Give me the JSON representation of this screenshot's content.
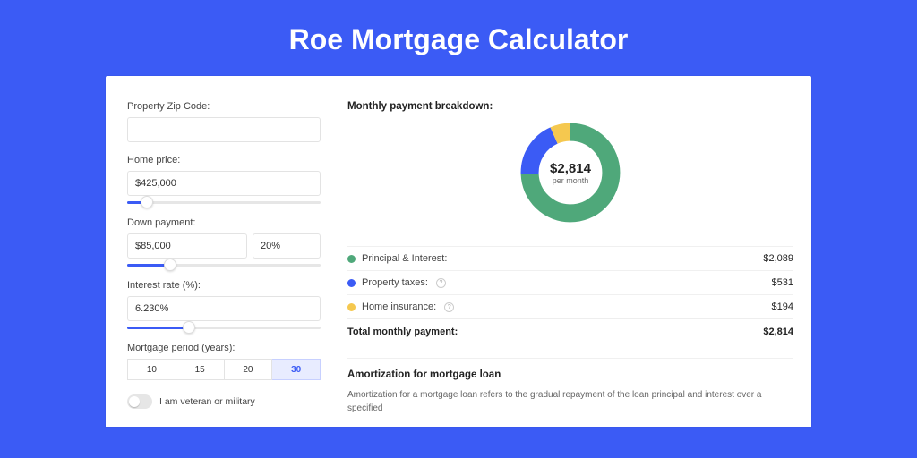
{
  "title": "Roe Mortgage Calculator",
  "form": {
    "zipLabel": "Property Zip Code:",
    "zipValue": "",
    "homePriceLabel": "Home price:",
    "homePriceValue": "$425,000",
    "homePriceSliderPct": 10,
    "downPaymentLabel": "Down payment:",
    "downPaymentValue": "$85,000",
    "downPaymentPctValue": "20%",
    "downPaymentSliderPct": 22,
    "interestLabel": "Interest rate (%):",
    "interestValue": "6.230%",
    "interestSliderPct": 32,
    "periodLabel": "Mortgage period (years):",
    "periodOptions": [
      "10",
      "15",
      "20",
      "30"
    ],
    "periodSelected": "30",
    "veteranLabel": "I am veteran or military"
  },
  "breakdown": {
    "title": "Monthly payment breakdown:",
    "centerAmount": "$2,814",
    "centerPer": "per month",
    "items": [
      {
        "label": "Principal & Interest:",
        "value": "$2,089",
        "color": "#4fa87a",
        "help": false
      },
      {
        "label": "Property taxes:",
        "value": "$531",
        "color": "#3b5bf5",
        "help": true
      },
      {
        "label": "Home insurance:",
        "value": "$194",
        "color": "#f5c84f",
        "help": true
      }
    ],
    "totalLabel": "Total monthly payment:",
    "totalValue": "$2,814"
  },
  "chart_data": {
    "type": "pie",
    "title": "Monthly payment breakdown",
    "series": [
      {
        "name": "Principal & Interest",
        "value": 2089,
        "color": "#4fa87a"
      },
      {
        "name": "Property taxes",
        "value": 531,
        "color": "#3b5bf5"
      },
      {
        "name": "Home insurance",
        "value": 194,
        "color": "#f5c84f"
      }
    ],
    "total": 2814,
    "units": "USD per month"
  },
  "amortization": {
    "title": "Amortization for mortgage loan",
    "text": "Amortization for a mortgage loan refers to the gradual repayment of the loan principal and interest over a specified"
  }
}
